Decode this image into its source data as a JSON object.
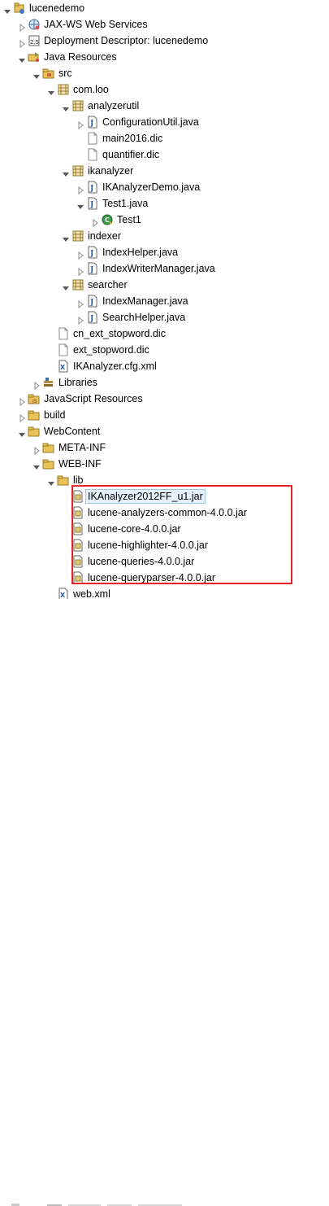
{
  "colors": {
    "highlight_box": "#e3242b",
    "selection": "#e5f1fb"
  },
  "tree": [
    {
      "label": "lucenedemo",
      "depth": 0,
      "toggle": "open",
      "icon": "project-icon"
    },
    {
      "label": "JAX-WS Web Services",
      "depth": 1,
      "toggle": "closed",
      "icon": "webservice-icon"
    },
    {
      "label": "Deployment Descriptor: lucenedemo",
      "depth": 1,
      "toggle": "closed",
      "icon": "deployment-descriptor-icon"
    },
    {
      "label": "Java Resources",
      "depth": 1,
      "toggle": "open",
      "icon": "java-resources-icon"
    },
    {
      "label": "src",
      "depth": 2,
      "toggle": "open",
      "icon": "source-folder-icon"
    },
    {
      "label": "com.loo",
      "depth": 3,
      "toggle": "open",
      "icon": "package-icon"
    },
    {
      "label": "analyzerutil",
      "depth": 4,
      "toggle": "open",
      "icon": "package-icon"
    },
    {
      "label": "ConfigurationUtil.java",
      "depth": 5,
      "toggle": "closed",
      "icon": "java-file-icon"
    },
    {
      "label": "main2016.dic",
      "depth": 5,
      "toggle": "none",
      "icon": "file-icon"
    },
    {
      "label": "quantifier.dic",
      "depth": 5,
      "toggle": "none",
      "icon": "file-icon"
    },
    {
      "label": "ikanalyzer",
      "depth": 4,
      "toggle": "open",
      "icon": "package-icon"
    },
    {
      "label": "IKAnalyzerDemo.java",
      "depth": 5,
      "toggle": "closed",
      "icon": "java-file-icon"
    },
    {
      "label": "Test1.java",
      "depth": 5,
      "toggle": "open",
      "icon": "java-file-icon"
    },
    {
      "label": "Test1",
      "depth": 6,
      "toggle": "closed",
      "icon": "class-runnable-icon"
    },
    {
      "label": "indexer",
      "depth": 4,
      "toggle": "open",
      "icon": "package-icon"
    },
    {
      "label": "IndexHelper.java",
      "depth": 5,
      "toggle": "closed",
      "icon": "java-file-icon"
    },
    {
      "label": "IndexWriterManager.java",
      "depth": 5,
      "toggle": "closed",
      "icon": "java-file-icon"
    },
    {
      "label": "searcher",
      "depth": 4,
      "toggle": "open",
      "icon": "package-icon"
    },
    {
      "label": "IndexManager.java",
      "depth": 5,
      "toggle": "closed",
      "icon": "java-file-icon"
    },
    {
      "label": "SearchHelper.java",
      "depth": 5,
      "toggle": "closed",
      "icon": "java-file-icon"
    },
    {
      "label": "cn_ext_stopword.dic",
      "depth": 3,
      "toggle": "none",
      "icon": "file-icon"
    },
    {
      "label": "ext_stopword.dic",
      "depth": 3,
      "toggle": "none",
      "icon": "file-icon"
    },
    {
      "label": "IKAnalyzer.cfg.xml",
      "depth": 3,
      "toggle": "none",
      "icon": "xml-file-icon"
    },
    {
      "label": "Libraries",
      "depth": 2,
      "toggle": "closed",
      "icon": "libraries-icon"
    },
    {
      "label": "JavaScript Resources",
      "depth": 1,
      "toggle": "closed",
      "icon": "javascript-resources-icon"
    },
    {
      "label": "build",
      "depth": 1,
      "toggle": "closed",
      "icon": "folder-icon"
    },
    {
      "label": "WebContent",
      "depth": 1,
      "toggle": "open",
      "icon": "folder-icon"
    },
    {
      "label": "META-INF",
      "depth": 2,
      "toggle": "closed",
      "icon": "folder-icon"
    },
    {
      "label": "WEB-INF",
      "depth": 2,
      "toggle": "open",
      "icon": "folder-icon"
    },
    {
      "label": "lib",
      "depth": 3,
      "toggle": "open",
      "icon": "folder-icon"
    },
    {
      "label": "IKAnalyzer2012FF_u1.jar",
      "depth": 4,
      "toggle": "none",
      "icon": "jar-file-icon",
      "selected": true
    },
    {
      "label": "lucene-analyzers-common-4.0.0.jar",
      "depth": 4,
      "toggle": "none",
      "icon": "jar-file-icon"
    },
    {
      "label": "lucene-core-4.0.0.jar",
      "depth": 4,
      "toggle": "none",
      "icon": "jar-file-icon"
    },
    {
      "label": "lucene-highlighter-4.0.0.jar",
      "depth": 4,
      "toggle": "none",
      "icon": "jar-file-icon"
    },
    {
      "label": "lucene-queries-4.0.0.jar",
      "depth": 4,
      "toggle": "none",
      "icon": "jar-file-icon"
    },
    {
      "label": "lucene-queryparser-4.0.0.jar",
      "depth": 4,
      "toggle": "none",
      "icon": "jar-file-icon"
    },
    {
      "label": "web.xml",
      "depth": 3,
      "toggle": "none",
      "icon": "xml-file-icon"
    }
  ]
}
